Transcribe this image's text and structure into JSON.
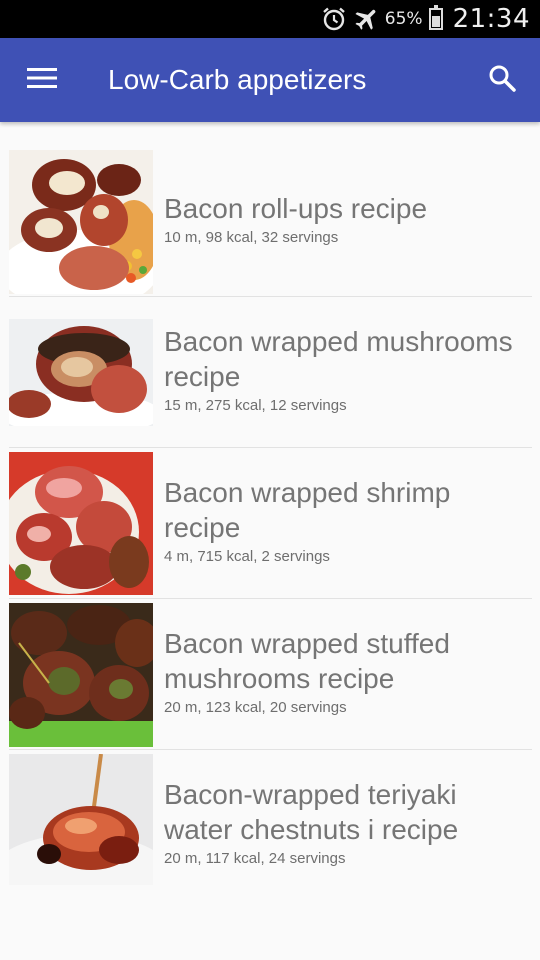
{
  "status_bar": {
    "battery": "65%",
    "time": "21:34",
    "icons": [
      "alarm-icon",
      "airplane-icon",
      "battery-icon"
    ]
  },
  "app_bar": {
    "title": "Low-Carb appetizers",
    "icons": [
      "menu-icon",
      "search-icon"
    ],
    "color": "#3f51b5"
  },
  "recipes": [
    {
      "title": "Bacon roll-ups recipe",
      "meta": "10 m, 98 kcal, 32 servings"
    },
    {
      "title": "Bacon wrapped mushrooms recipe",
      "meta": "15 m, 275 kcal, 12 servings"
    },
    {
      "title": "Bacon wrapped shrimp recipe",
      "meta": "4 m, 715 kcal, 2 servings"
    },
    {
      "title": "Bacon wrapped stuffed mushrooms recipe",
      "meta": "20 m, 123 kcal, 20 servings"
    },
    {
      "title": "Bacon-wrapped teriyaki water chestnuts i recipe",
      "meta": "20 m, 117 kcal, 24 servings"
    }
  ]
}
